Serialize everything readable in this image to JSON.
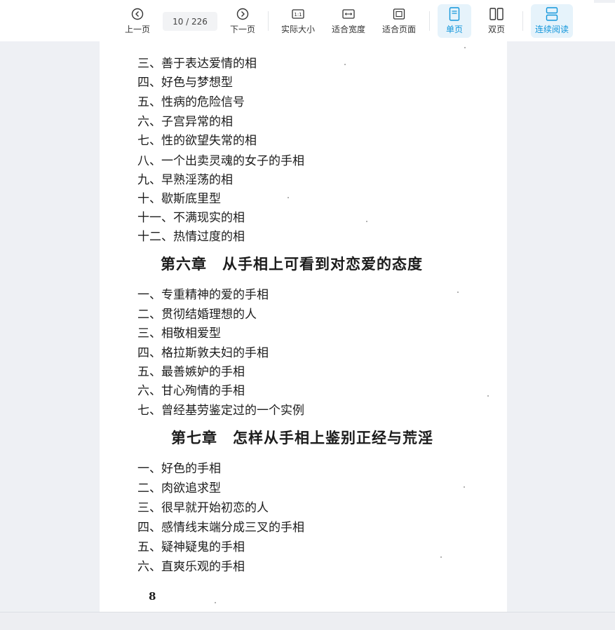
{
  "toolbar": {
    "prev_label": "上一页",
    "page_indicator": "10 / 226",
    "next_label": "下一页",
    "actual_size_label": "实际大小",
    "fit_width_label": "适合宽度",
    "fit_page_label": "适合页面",
    "single_page_label": "单页",
    "double_page_label": "双页",
    "continuous_label": "连续阅读",
    "active_color": "#1296db"
  },
  "document": {
    "list_top": [
      "三、善于表达爱情的相",
      "四、好色与梦想型",
      "五、性病的危险信号",
      "六、子宫异常的相",
      "七、性的欲望失常的相",
      "八、一个出卖灵魂的女子的手相",
      "九、早熟淫荡的相",
      "十、歇斯底里型",
      "十一、不满现实的相",
      "十二、热情过度的相"
    ],
    "chapter6_title": "第六章　从手相上可看到对恋爱的态度",
    "chapter6_items": [
      "一、专重精神的爱的手相",
      "二、贯彻结婚理想的人",
      "三、相敬相爱型",
      "四、格拉斯敦夫妇的手相",
      "五、最善嫉妒的手相",
      "六、甘心殉情的手相",
      "七、曾经基劳鉴定过的一个实例"
    ],
    "chapter7_title": "第七章　怎样从手相上鉴别正经与荒淫",
    "chapter7_items": [
      "一、好色的手相",
      "二、肉欲追求型",
      "三、很早就开始初恋的人",
      "四、感情线末端分成三叉的手相",
      "五、疑神疑鬼的手相",
      "六、直爽乐观的手相"
    ],
    "page_number": "8"
  }
}
